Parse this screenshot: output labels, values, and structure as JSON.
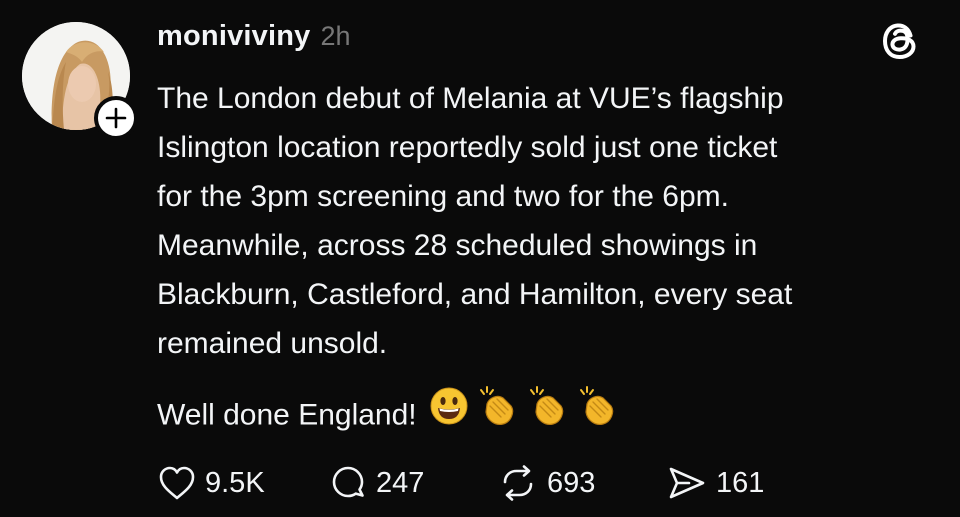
{
  "author": {
    "username": "moniviviny",
    "time_ago": "2h"
  },
  "post": {
    "paragraph_1": "The London debut of Melania at VUE’s flagship\nIslington location reportedly sold just one ticket\nfor the 3pm screening and two for the 6pm.\nMeanwhile, across 28 scheduled showings in\nBlackburn, Castleford, and Hamilton, every seat\nremained unsold.",
    "paragraph_2": "Well done England!",
    "emojis": [
      "grinning-face",
      "clapping-hands",
      "clapping-hands",
      "clapping-hands"
    ]
  },
  "actions": {
    "likes": "9.5K",
    "replies": "247",
    "reposts": "693",
    "shares": "161"
  },
  "icons": {
    "like": "heart-icon",
    "reply": "comment-bubble-icon",
    "repost": "repost-icon",
    "share": "send-icon",
    "brand": "threads-logo-icon",
    "follow": "plus-icon"
  },
  "colors": {
    "background": "#0a0a0a",
    "text": "#f3f5f7",
    "muted": "#777777"
  }
}
